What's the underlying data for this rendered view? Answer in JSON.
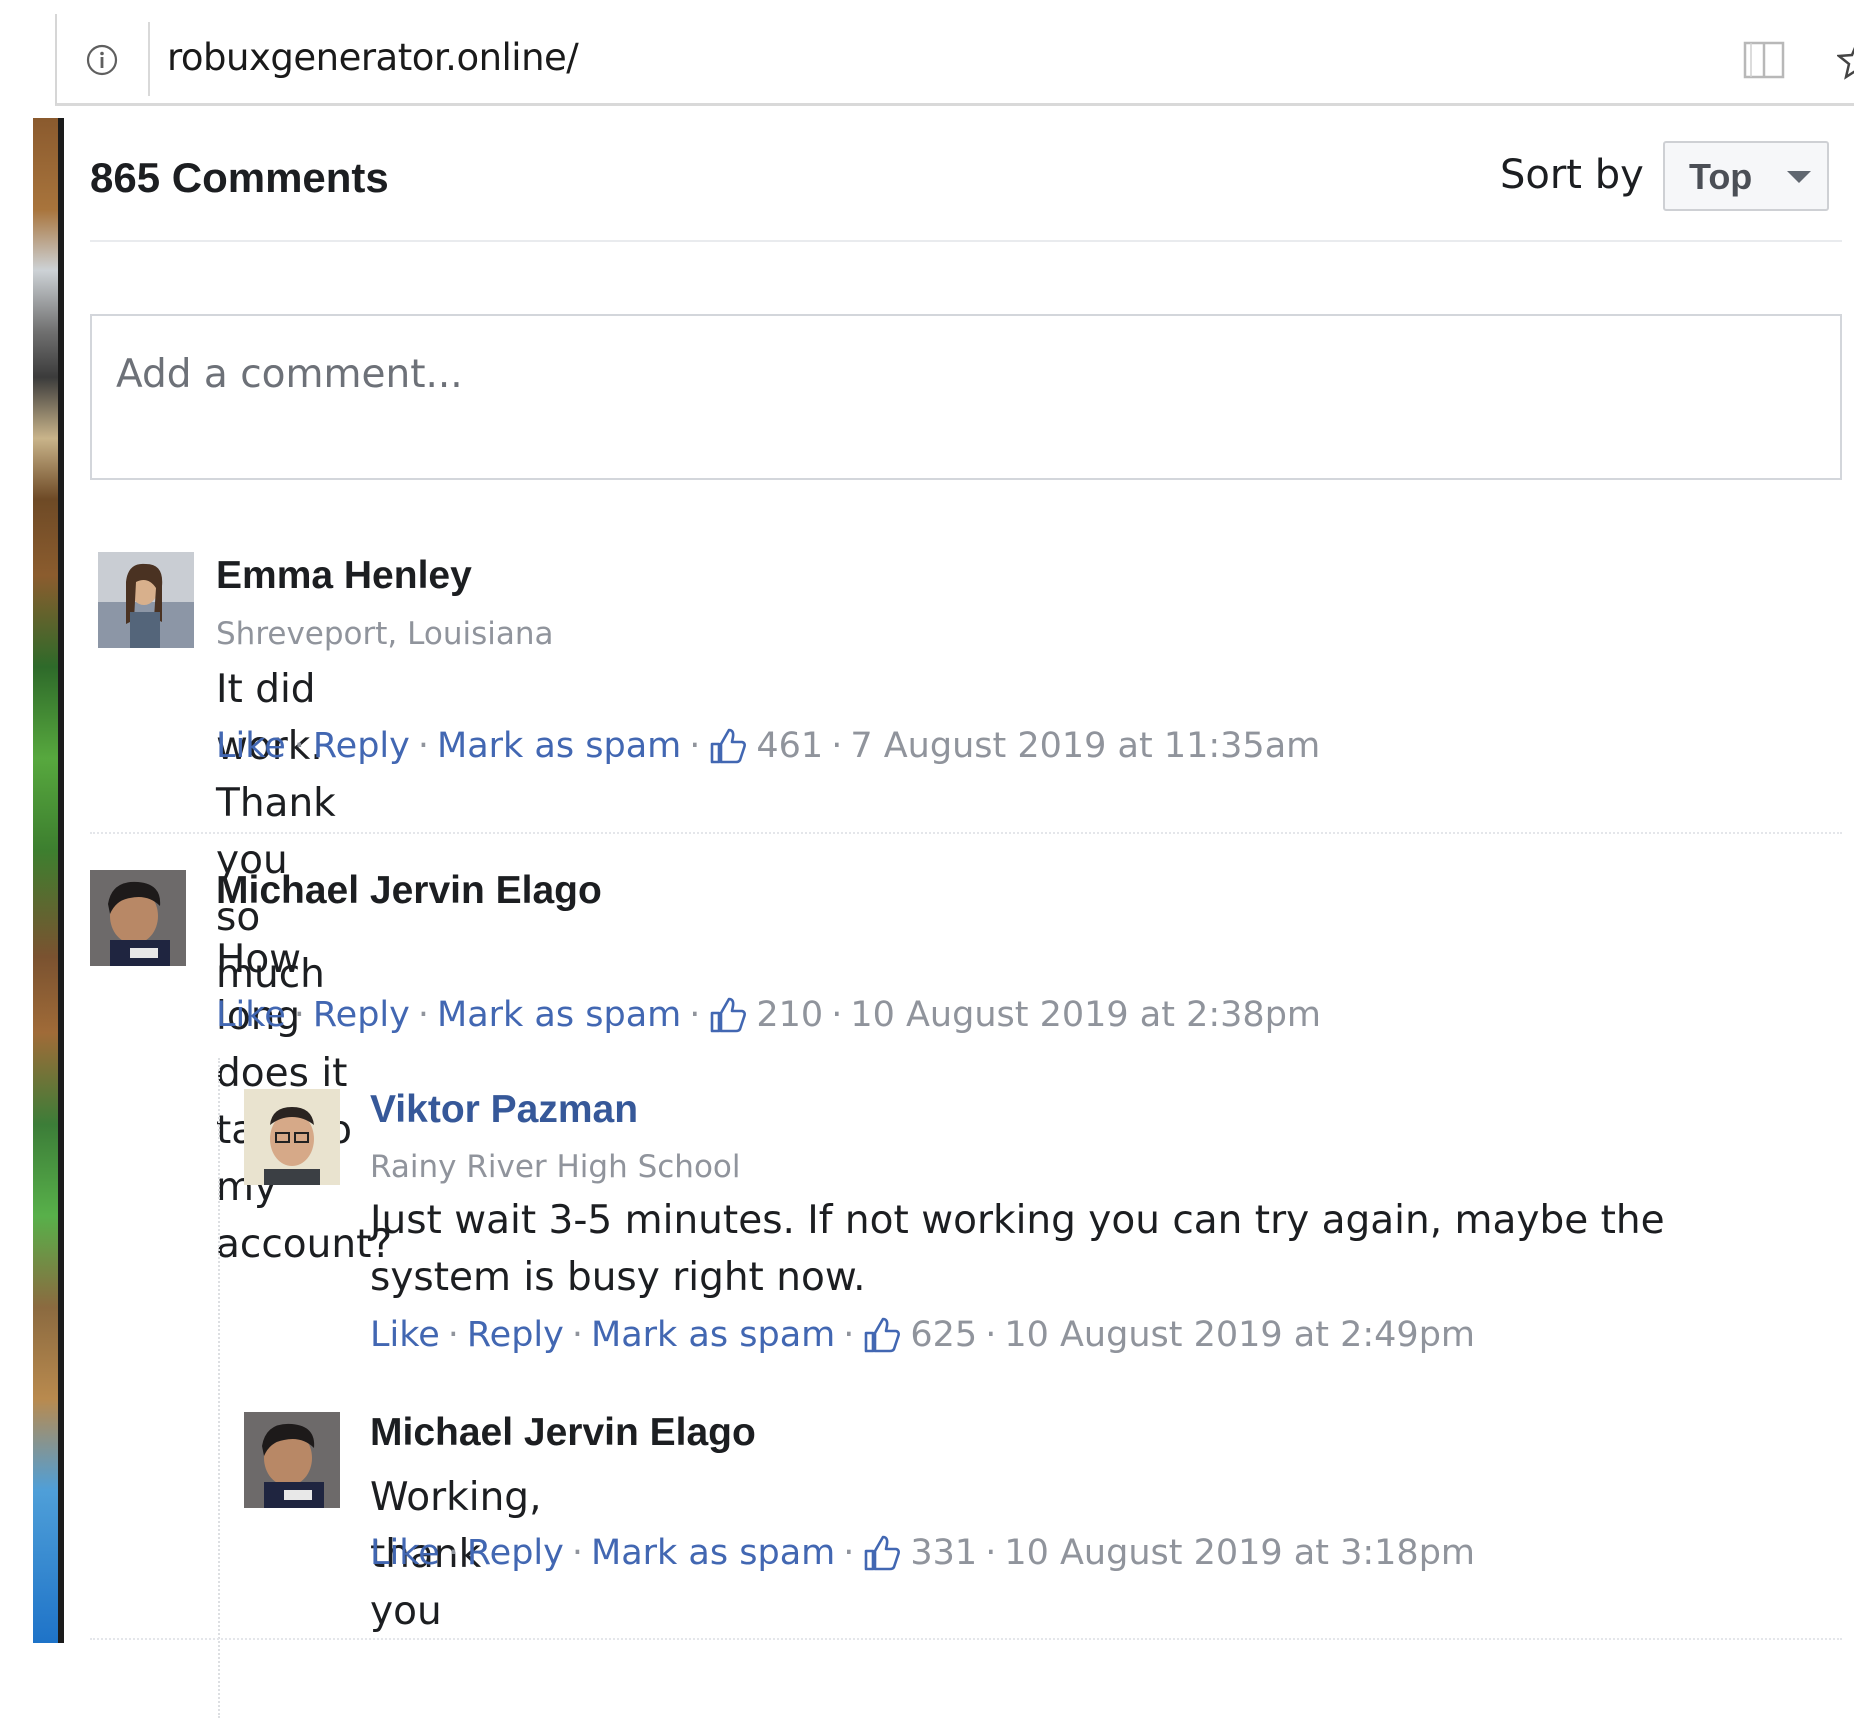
{
  "browser": {
    "url": "robuxgenerator.online/",
    "icons": {
      "info": "info-icon",
      "reader": "reader-view-icon",
      "bookmark": "star-icon"
    }
  },
  "comments_section": {
    "count_label": "865 Comments",
    "sort_label": "Sort by",
    "sort_value": "Top",
    "input_placeholder": "Add a comment...",
    "action_labels": {
      "like": "Like",
      "reply": "Reply",
      "spam": "Mark as spam",
      "separator": "·"
    },
    "link_color": "#4267b2",
    "name_link_color": "#365899",
    "comments": [
      {
        "author": "Emma Henley",
        "subtitle": "Shreveport, Louisiana",
        "text": "It did work. Thank you so much",
        "likes": "461",
        "date": "7 August 2019 at 11:35am"
      },
      {
        "author": "Michael Jervin Elago",
        "subtitle": "",
        "text": "How long does it take to my account?",
        "likes": "210",
        "date": "10 August 2019 at 2:38pm",
        "replies": [
          {
            "author": "Viktor Pazman",
            "subtitle": "Rainy River High School",
            "text": "Just wait 3-5 minutes. If not working you can try again, maybe the system is busy right now.",
            "likes": "625",
            "date": "10 August 2019 at 2:49pm"
          },
          {
            "author": "Michael Jervin Elago",
            "subtitle": "",
            "text": "Working, thank you",
            "likes": "331",
            "date": "10 August 2019 at 3:18pm"
          }
        ]
      }
    ]
  }
}
